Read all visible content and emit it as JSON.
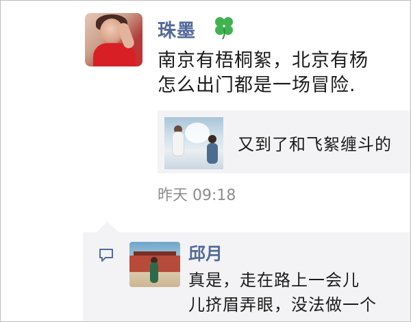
{
  "post": {
    "author": "珠墨",
    "author_badge_icon": "four-leaf-clover-icon",
    "text_lines": [
      "南京有梧桐絮，北京有杨",
      "怎么出门都是一场冒险."
    ],
    "link_card": {
      "title": "又到了和飞絮缠斗的"
    },
    "time": "昨天 09:18"
  },
  "comment": {
    "icon": "comment-bubble-icon",
    "author": "邱月",
    "text_lines": [
      "真是，走在路上一会儿",
      "儿挤眉弄眼，没法做一个"
    ]
  },
  "colors": {
    "name_link": "#536a99",
    "time_gray": "#8c8c8c",
    "panel_bg": "#f3f3f5",
    "clover_green": "#3fb34f"
  }
}
